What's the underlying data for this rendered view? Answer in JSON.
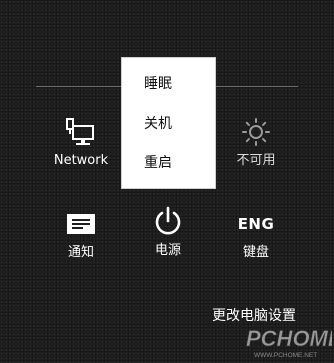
{
  "quick_settings": {
    "network": {
      "label": "Network",
      "icon": "network-icon"
    },
    "brightness": {
      "label": "不可用",
      "icon": "brightness-icon"
    },
    "notifications": {
      "label": "通知",
      "icon": "notification-icon"
    },
    "power": {
      "label": "电源",
      "icon": "power-icon"
    },
    "keyboard": {
      "label": "键盘",
      "icon_text": "ENG"
    }
  },
  "power_menu": {
    "items": [
      {
        "label": "睡眠"
      },
      {
        "label": "关机"
      },
      {
        "label": "重启"
      }
    ]
  },
  "footer": {
    "change_pc_settings": "更改电脑设置"
  },
  "watermark": {
    "brand": "PCHOME",
    "url": "WWW.PCHOME.NET"
  },
  "colors": {
    "background": "#1f1f1f",
    "menu_background": "#ffffff",
    "menu_text": "#111111",
    "text": "#ffffff"
  }
}
